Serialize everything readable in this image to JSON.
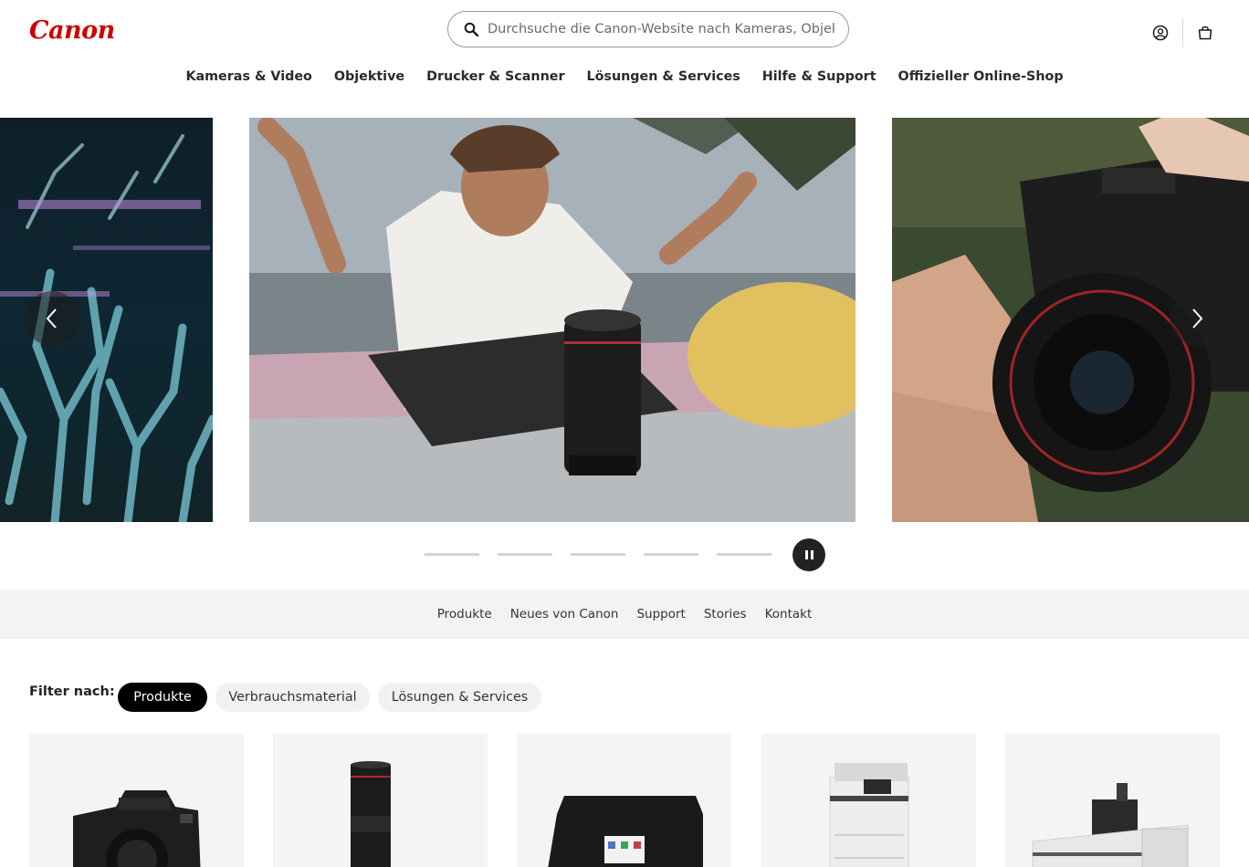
{
  "header": {
    "logo": "Canon",
    "search_placeholder": "Durchsuche die Canon-Website nach Kameras, Objektiven",
    "icons": [
      "search-icon",
      "account-icon",
      "shopping-bag-icon"
    ]
  },
  "main_nav": [
    "Kameras & Video",
    "Objektive",
    "Drucker & Scanner",
    "Lösungen & Services",
    "Hilfe & Support",
    "Offizieller Online-Shop"
  ],
  "carousel": {
    "slides": [
      "coral-reef-photo",
      "skateboarder-lens-photo",
      "camera-in-hands-photo"
    ],
    "indicator_count": 5,
    "controls": [
      "chevron-left-icon",
      "chevron-right-icon",
      "pause-icon"
    ]
  },
  "sub_nav": [
    "Produkte",
    "Neues von Canon",
    "Support",
    "Stories",
    "Kontakt"
  ],
  "filters": {
    "label": "Filter nach:",
    "options": [
      "Produkte",
      "Verbrauchsmaterial",
      "Lösungen & Services"
    ],
    "selected": "Produkte"
  },
  "product_cards": [
    "camera",
    "lens",
    "printer",
    "office-multifunction-printer",
    "large-format-printer"
  ],
  "colors": {
    "brand_red": "#cc0000",
    "chip_active": "#000000",
    "chip_inactive": "#f1f1f1",
    "subnav_bg": "#f3f3f3",
    "card_bg": "#f4f4f4"
  }
}
